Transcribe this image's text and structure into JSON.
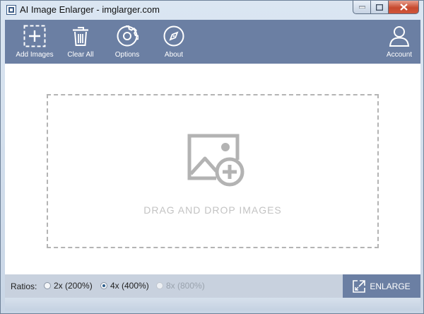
{
  "window": {
    "title": "AI Image Enlarger - imglarger.com"
  },
  "toolbar": {
    "items": [
      {
        "label": "Add Images",
        "icon": "add-image-icon"
      },
      {
        "label": "Clear All",
        "icon": "trash-icon"
      },
      {
        "label": "Options",
        "icon": "gear-icon"
      },
      {
        "label": "About",
        "icon": "compass-icon"
      }
    ],
    "account": {
      "label": "Account",
      "icon": "user-icon"
    }
  },
  "dropzone": {
    "text": "DRAG AND DROP IMAGES",
    "icon": "image-add-icon"
  },
  "bottom": {
    "ratios_label": "Ratios:",
    "ratios": [
      {
        "label": "2x (200%)",
        "checked": false,
        "enabled": true
      },
      {
        "label": "4x (400%)",
        "checked": true,
        "enabled": true
      },
      {
        "label": "8x (800%)",
        "checked": false,
        "enabled": false
      }
    ],
    "enlarge_label": "ENLARGE"
  },
  "colors": {
    "toolbar_bg": "#6b7fa3",
    "accent_radio": "#2c5d8a",
    "dropzone_border": "#b4b4b4"
  }
}
